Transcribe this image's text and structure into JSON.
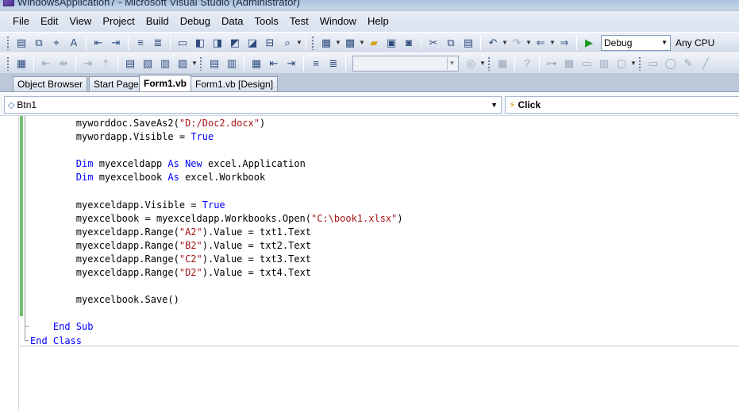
{
  "window": {
    "title": "WindowsApplication7 - Microsoft Visual Studio (Administrator)"
  },
  "menu": [
    "File",
    "Edit",
    "View",
    "Project",
    "Build",
    "Debug",
    "Data",
    "Tools",
    "Test",
    "Window",
    "Help"
  ],
  "toolbar": {
    "configuration": "Debug",
    "platform": "Any CPU"
  },
  "tabs": [
    "Object Browser",
    "Start Page",
    "Form1.vb",
    "Form1.vb [Design]"
  ],
  "active_tab": "Form1.vb",
  "navigation": {
    "object": "Btn1",
    "event": "Click"
  },
  "colors": {
    "keyword": "#0000ff",
    "string": "#a31515",
    "change_bar": "#70c070"
  },
  "code": [
    [
      {
        "t": "        myworddoc.SaveAs2(",
        "c": "plain"
      },
      {
        "t": "\"D:/Doc2.docx\"",
        "c": "str"
      },
      {
        "t": ")",
        "c": "plain"
      }
    ],
    [
      {
        "t": "        mywordapp.Visible = ",
        "c": "plain"
      },
      {
        "t": "True",
        "c": "kw"
      }
    ],
    [],
    [
      {
        "t": "        ",
        "c": "plain"
      },
      {
        "t": "Dim",
        "c": "kw"
      },
      {
        "t": " myexceldapp ",
        "c": "plain"
      },
      {
        "t": "As New",
        "c": "kw"
      },
      {
        "t": " excel.Application",
        "c": "plain"
      }
    ],
    [
      {
        "t": "        ",
        "c": "plain"
      },
      {
        "t": "Dim",
        "c": "kw"
      },
      {
        "t": " myexcelbook ",
        "c": "plain"
      },
      {
        "t": "As",
        "c": "kw"
      },
      {
        "t": " excel.Workbook",
        "c": "plain"
      }
    ],
    [],
    [
      {
        "t": "        myexceldapp.Visible = ",
        "c": "plain"
      },
      {
        "t": "True",
        "c": "kw"
      }
    ],
    [
      {
        "t": "        myexcelbook = myexceldapp.Workbooks.Open(",
        "c": "plain"
      },
      {
        "t": "\"C:\\book1.xlsx\"",
        "c": "str"
      },
      {
        "t": ")",
        "c": "plain"
      }
    ],
    [
      {
        "t": "        myexceldapp.Range(",
        "c": "plain"
      },
      {
        "t": "\"A2\"",
        "c": "str"
      },
      {
        "t": ").Value = txt1.Text",
        "c": "plain"
      }
    ],
    [
      {
        "t": "        myexceldapp.Range(",
        "c": "plain"
      },
      {
        "t": "\"B2\"",
        "c": "str"
      },
      {
        "t": ").Value = txt2.Text",
        "c": "plain"
      }
    ],
    [
      {
        "t": "        myexceldapp.Range(",
        "c": "plain"
      },
      {
        "t": "\"C2\"",
        "c": "str"
      },
      {
        "t": ").Value = txt3.Text",
        "c": "plain"
      }
    ],
    [
      {
        "t": "        myexceldapp.Range(",
        "c": "plain"
      },
      {
        "t": "\"D2\"",
        "c": "str"
      },
      {
        "t": ").Value = txt4.Text",
        "c": "plain"
      }
    ],
    [],
    [
      {
        "t": "        myexcelbook.Save()",
        "c": "plain"
      }
    ],
    [],
    [
      {
        "t": "    ",
        "c": "plain"
      },
      {
        "t": "End Sub",
        "c": "kw"
      }
    ],
    [
      {
        "t": "End Class",
        "c": "kw"
      }
    ]
  ]
}
